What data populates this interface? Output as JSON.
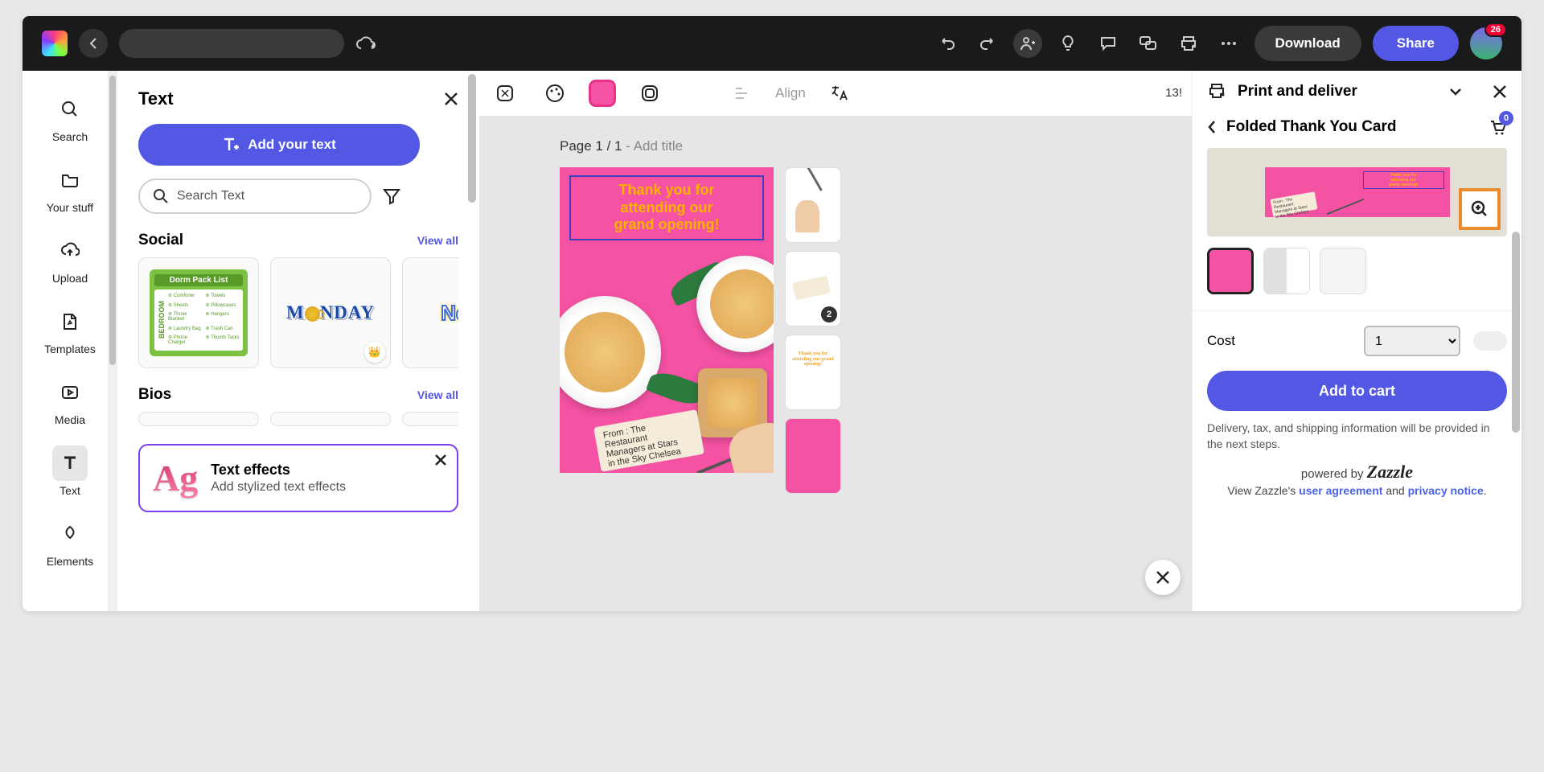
{
  "topbar": {
    "download": "Download",
    "share": "Share",
    "notifications": "26"
  },
  "rail": {
    "items": [
      {
        "label": "Search"
      },
      {
        "label": "Your stuff"
      },
      {
        "label": "Upload"
      },
      {
        "label": "Templates"
      },
      {
        "label": "Media"
      },
      {
        "label": "Text"
      },
      {
        "label": "Elements"
      }
    ]
  },
  "textPanel": {
    "title": "Text",
    "addButton": "Add your text",
    "searchPlaceholder": "Search Text",
    "sections": {
      "social": {
        "title": "Social",
        "viewAll": "View all"
      },
      "bios": {
        "title": "Bios",
        "viewAll": "View all"
      }
    },
    "thumbs": {
      "dorm": {
        "title": "Dorm Pack List",
        "side": "BEDROOM",
        "items": [
          "Comforter",
          "Sheets",
          "Throw Blanket",
          "Laundry Bag",
          "Phone Charger",
          "Towels",
          "Pillowcases",
          "Hangers",
          "Trash Can",
          "Thumb Tacks"
        ]
      },
      "monday": "M NDAY",
      "new": "New"
    },
    "fx": {
      "title": "Text effects",
      "subtitle": "Add stylized text effects",
      "sample": "Ag"
    }
  },
  "canvas": {
    "toolbar": {
      "align": "Align",
      "zoom": "13!"
    },
    "pageLabel": "Page 1 / 1",
    "pageHint": " - Add title",
    "card": {
      "headline1": "Thank you for",
      "headline2": "attending our",
      "headline3": "grand opening!",
      "tag1": "From : The Restaurant",
      "tag2": "Managers at Stars",
      "tag3": "in the Sky Chelsea"
    },
    "miniThumbs": {
      "num2": "2",
      "yellow": "Thank you for attending our grand opening!"
    }
  },
  "print": {
    "title": "Print and deliver",
    "subtitle": "Folded Thank You Card",
    "cartCount": "0",
    "costLabel": "Cost",
    "qty": "1",
    "addToCart": "Add to cart",
    "note": "Delivery, tax, and shipping information will be provided in the next steps.",
    "poweredPrefix": "powered by ",
    "poweredBrand": "Zazzle",
    "legal1": "View Zazzle's ",
    "legalUA": "user agreement",
    "legalAnd": " and ",
    "legalPN": "privacy notice",
    "legalEnd": "."
  }
}
